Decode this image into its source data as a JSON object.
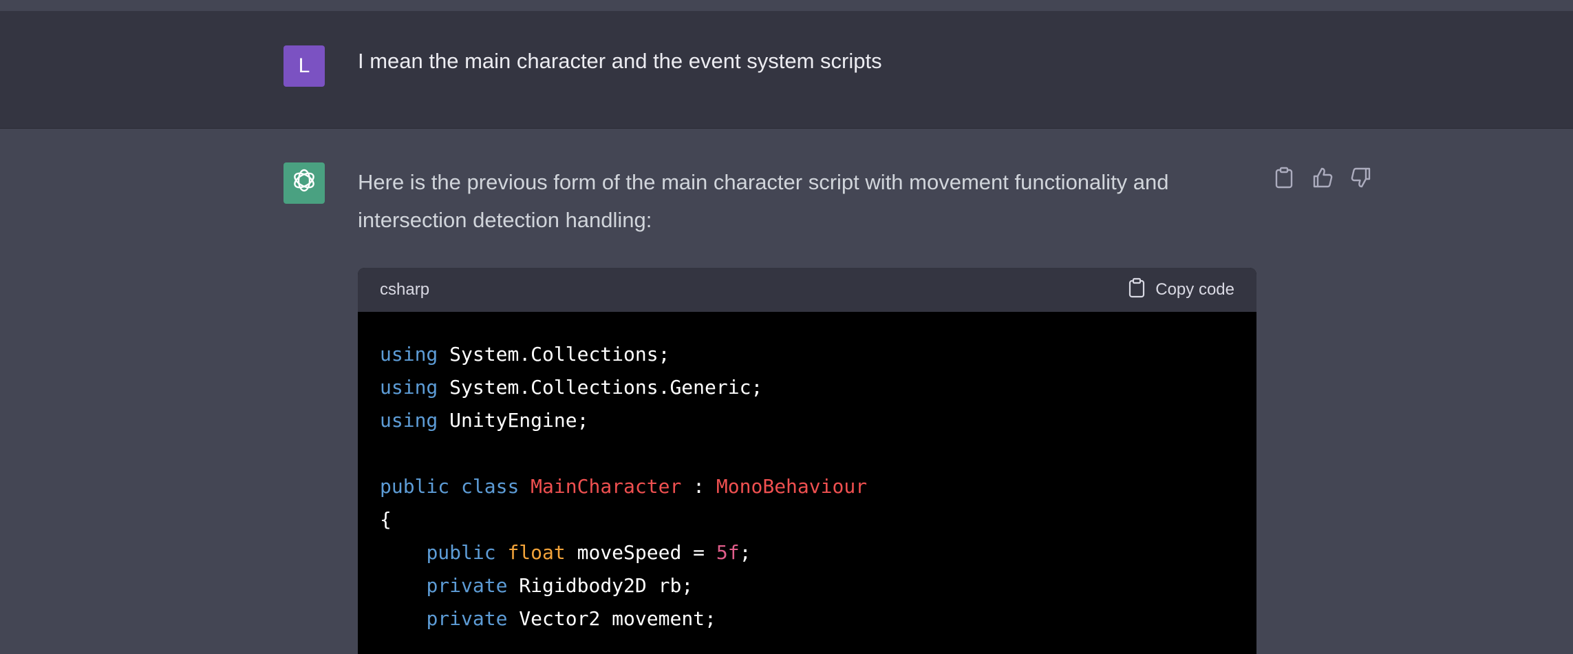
{
  "user_message": {
    "avatar_letter": "L",
    "text": "I mean the main character and the event system scripts"
  },
  "assistant_message": {
    "text": "Here is the previous form of the main character script with movement functionality and intersection detection handling:",
    "actions": {
      "copy_icon": "clipboard-icon",
      "like_icon": "thumbs-up-icon",
      "dislike_icon": "thumbs-down-icon"
    }
  },
  "code_block": {
    "language": "csharp",
    "copy_label": "Copy code",
    "lines": [
      [
        {
          "t": "using",
          "c": "kw"
        },
        {
          "t": " System.Collections;",
          "c": "plain"
        }
      ],
      [
        {
          "t": "using",
          "c": "kw"
        },
        {
          "t": " System.Collections.Generic;",
          "c": "plain"
        }
      ],
      [
        {
          "t": "using",
          "c": "kw"
        },
        {
          "t": " UnityEngine;",
          "c": "plain"
        }
      ],
      [],
      [
        {
          "t": "public",
          "c": "kw"
        },
        {
          "t": " ",
          "c": "plain"
        },
        {
          "t": "class",
          "c": "kw"
        },
        {
          "t": " ",
          "c": "plain"
        },
        {
          "t": "MainCharacter",
          "c": "cls"
        },
        {
          "t": " : ",
          "c": "plain"
        },
        {
          "t": "MonoBehaviour",
          "c": "cls"
        }
      ],
      [
        {
          "t": "{",
          "c": "plain"
        }
      ],
      [
        {
          "t": "    ",
          "c": "plain"
        },
        {
          "t": "public",
          "c": "kw"
        },
        {
          "t": " ",
          "c": "plain"
        },
        {
          "t": "float",
          "c": "type"
        },
        {
          "t": " moveSpeed = ",
          "c": "plain"
        },
        {
          "t": "5f",
          "c": "num"
        },
        {
          "t": ";",
          "c": "plain"
        }
      ],
      [
        {
          "t": "    ",
          "c": "plain"
        },
        {
          "t": "private",
          "c": "kw"
        },
        {
          "t": " Rigidbody2D rb;",
          "c": "plain"
        }
      ],
      [
        {
          "t": "    ",
          "c": "plain"
        },
        {
          "t": "private",
          "c": "kw"
        },
        {
          "t": " Vector2 movement;",
          "c": "plain"
        }
      ]
    ]
  },
  "colors": {
    "user_bg": "#343541",
    "assistant_bg": "#444654",
    "user_avatar": "#7b52c2",
    "bot_avatar": "#4aa181",
    "keyword": "#5d9cd6",
    "type": "#f2a33a",
    "class_name": "#ef5050",
    "number": "#e05d8a"
  }
}
